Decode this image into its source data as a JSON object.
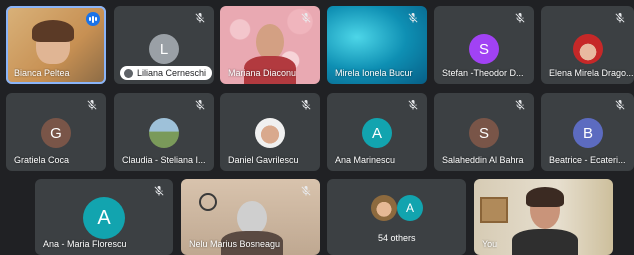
{
  "participants": {
    "bianca": {
      "name": "Bianca Peltea"
    },
    "liliana": {
      "name": "Liliana Cerneschi"
    },
    "mariana": {
      "name": "Mariana Diaconu"
    },
    "mirela": {
      "name": "Mirela Ionela Bucur"
    },
    "stefan": {
      "name": "Stefan -Theodor D...",
      "initial": "S",
      "color": "#a142f4"
    },
    "elena": {
      "name": "Elena Mirela Drago..."
    },
    "gratiela": {
      "name": "Gratiela Coca",
      "initial": "G",
      "color": "#795548"
    },
    "claudia": {
      "name": "Claudia - Steliana I..."
    },
    "daniel": {
      "name": "Daniel Gavrilescu"
    },
    "ana_m": {
      "name": "Ana Marinescu",
      "initial": "A",
      "color": "#12a4af"
    },
    "salaheddin": {
      "name": "Salaheddin Al Bahra",
      "initial": "S",
      "color": "#795548"
    },
    "beatrice": {
      "name": "Beatrice - Ecateri...",
      "initial": "B",
      "color": "#5c6bc0"
    },
    "ana_f": {
      "name": "Ana - Maria Florescu",
      "initial": "A",
      "color": "#12a4af"
    },
    "nelu": {
      "name": "Nelu Marius Bosneagu"
    },
    "others": {
      "label": "54 others",
      "initial": "A",
      "color": "#12a4af"
    },
    "you": {
      "name": "You"
    }
  },
  "liliana_initial": "L"
}
